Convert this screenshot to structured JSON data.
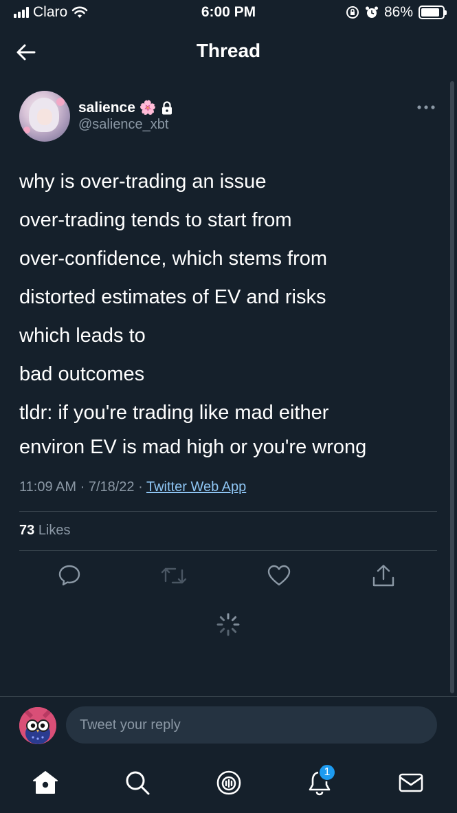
{
  "status_bar": {
    "carrier": "Claro",
    "time": "6:00 PM",
    "battery_percent": "86%",
    "battery_level": 0.86
  },
  "nav": {
    "title": "Thread"
  },
  "tweet": {
    "author_name": "salience",
    "name_emoji": "🌸",
    "handle": "@salience_xbt",
    "lines": [
      "why is over-trading an issue",
      "over-trading tends to start from",
      "over-confidence, which stems from",
      "distorted estimates of EV and risks",
      "which leads to",
      "bad outcomes",
      "tldr: if you're trading like mad either",
      "environ EV is mad high or you're wrong"
    ],
    "time": "11:09 AM",
    "date": "7/18/22",
    "source": "Twitter Web App",
    "likes_count": "73",
    "likes_label": "Likes"
  },
  "reply": {
    "placeholder": "Tweet your reply"
  },
  "tabs": {
    "notifications_badge": "1"
  },
  "colors": {
    "background": "#15202b",
    "accent": "#1d9bf0",
    "muted": "#8b98a5",
    "link": "#8ec5f3"
  }
}
